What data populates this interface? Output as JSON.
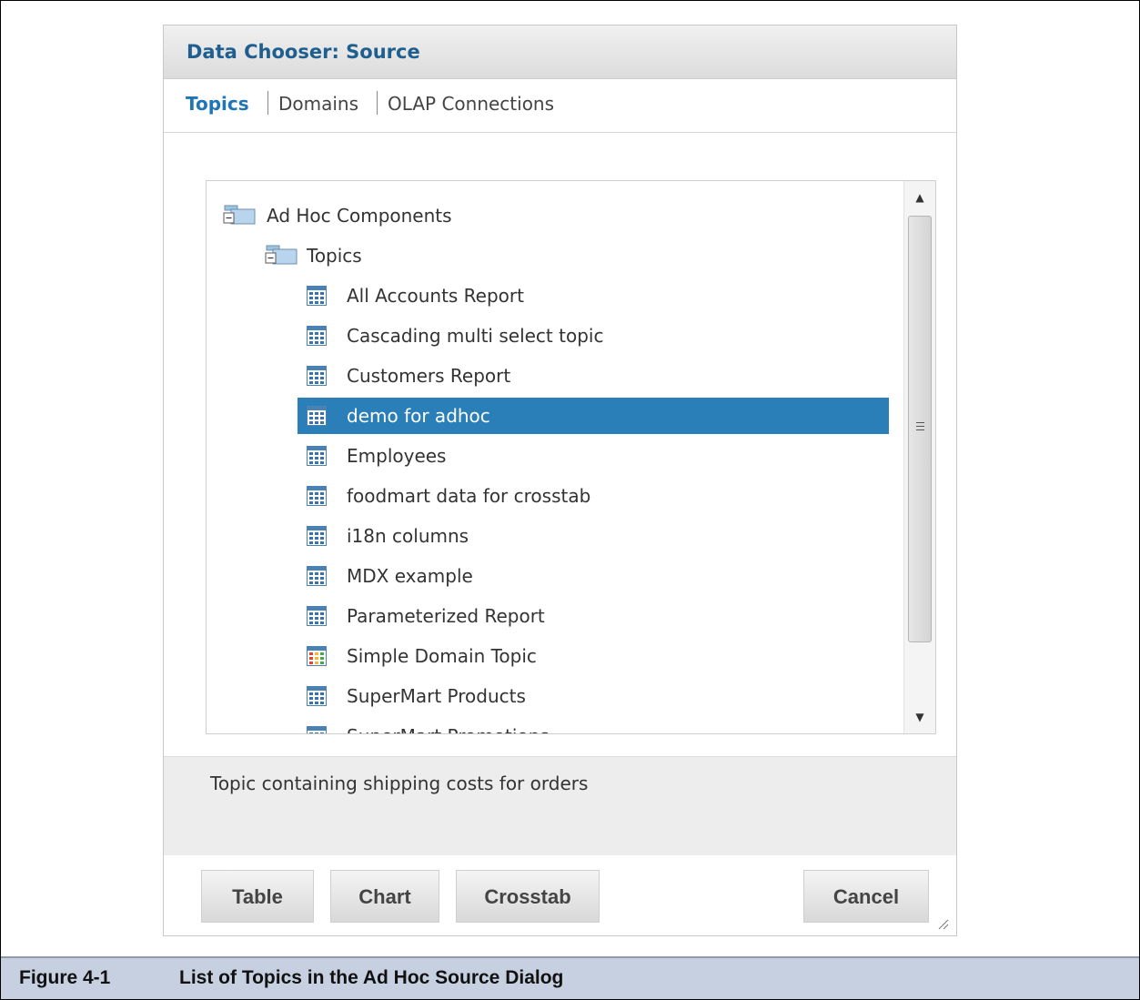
{
  "dialog": {
    "title": "Data Chooser: Source",
    "tabs": [
      {
        "label": "Topics",
        "active": true
      },
      {
        "label": "Domains",
        "active": false
      },
      {
        "label": "OLAP Connections",
        "active": false
      }
    ]
  },
  "tree": {
    "root": {
      "label": "Ad Hoc Components",
      "icon": "folder-icon",
      "expanded": true
    },
    "folder": {
      "label": "Topics",
      "icon": "folder-icon",
      "expanded": true
    },
    "items": [
      {
        "label": "All Accounts Report",
        "icon": "topic-icon",
        "selected": false
      },
      {
        "label": "Cascading multi select topic",
        "icon": "topic-icon",
        "selected": false
      },
      {
        "label": "Customers Report",
        "icon": "topic-icon",
        "selected": false
      },
      {
        "label": "demo for adhoc",
        "icon": "topic-icon",
        "selected": true
      },
      {
        "label": "Employees",
        "icon": "topic-icon",
        "selected": false
      },
      {
        "label": "foodmart data for crosstab",
        "icon": "topic-icon",
        "selected": false
      },
      {
        "label": "i18n columns",
        "icon": "topic-icon",
        "selected": false
      },
      {
        "label": "MDX example",
        "icon": "topic-icon",
        "selected": false
      },
      {
        "label": "Parameterized Report",
        "icon": "topic-icon",
        "selected": false
      },
      {
        "label": "Simple Domain Topic",
        "icon": "domain-topic-icon",
        "selected": false
      },
      {
        "label": "SuperMart Products",
        "icon": "topic-icon",
        "selected": false
      },
      {
        "label": "SuperMart Promotions",
        "icon": "topic-icon",
        "selected": false
      }
    ]
  },
  "description": "Topic containing shipping costs for orders",
  "buttons": {
    "table": "Table",
    "chart": "Chart",
    "crosstab": "Crosstab",
    "cancel": "Cancel"
  },
  "caption": {
    "number": "Figure 4-1",
    "title": "List of Topics in the Ad Hoc Source Dialog"
  },
  "colors": {
    "accent": "#1f75b5",
    "selection": "#2a7fb8",
    "caption_bg": "#c6d0e0"
  }
}
